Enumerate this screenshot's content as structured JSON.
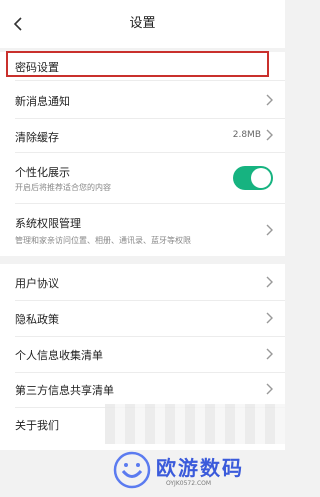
{
  "header": {
    "title": "设置"
  },
  "items": {
    "password": {
      "label": "密码设置"
    },
    "notify": {
      "label": "新消息通知"
    },
    "cache": {
      "label": "清除缓存",
      "value": "2.8MB"
    },
    "personal": {
      "label": "个性化展示",
      "sub": "开启后将推荐适合您的内容",
      "toggle_on": true
    },
    "permission": {
      "label": "系统权限管理",
      "sub": "管理和家亲访问位置、相册、通讯录、蓝牙等权限"
    },
    "agreement": {
      "label": "用户协议"
    },
    "privacy": {
      "label": "隐私政策"
    },
    "collect": {
      "label": "个人信息收集清单"
    },
    "share": {
      "label": "第三方信息共享清单"
    },
    "about": {
      "label": "关于我们"
    }
  },
  "watermark": {
    "text": "欧游数码",
    "sub": "OYJK0572.COM"
  },
  "colors": {
    "accent": "#16b380",
    "highlight": "#c9302c",
    "watermark": "#3b5bdb"
  }
}
